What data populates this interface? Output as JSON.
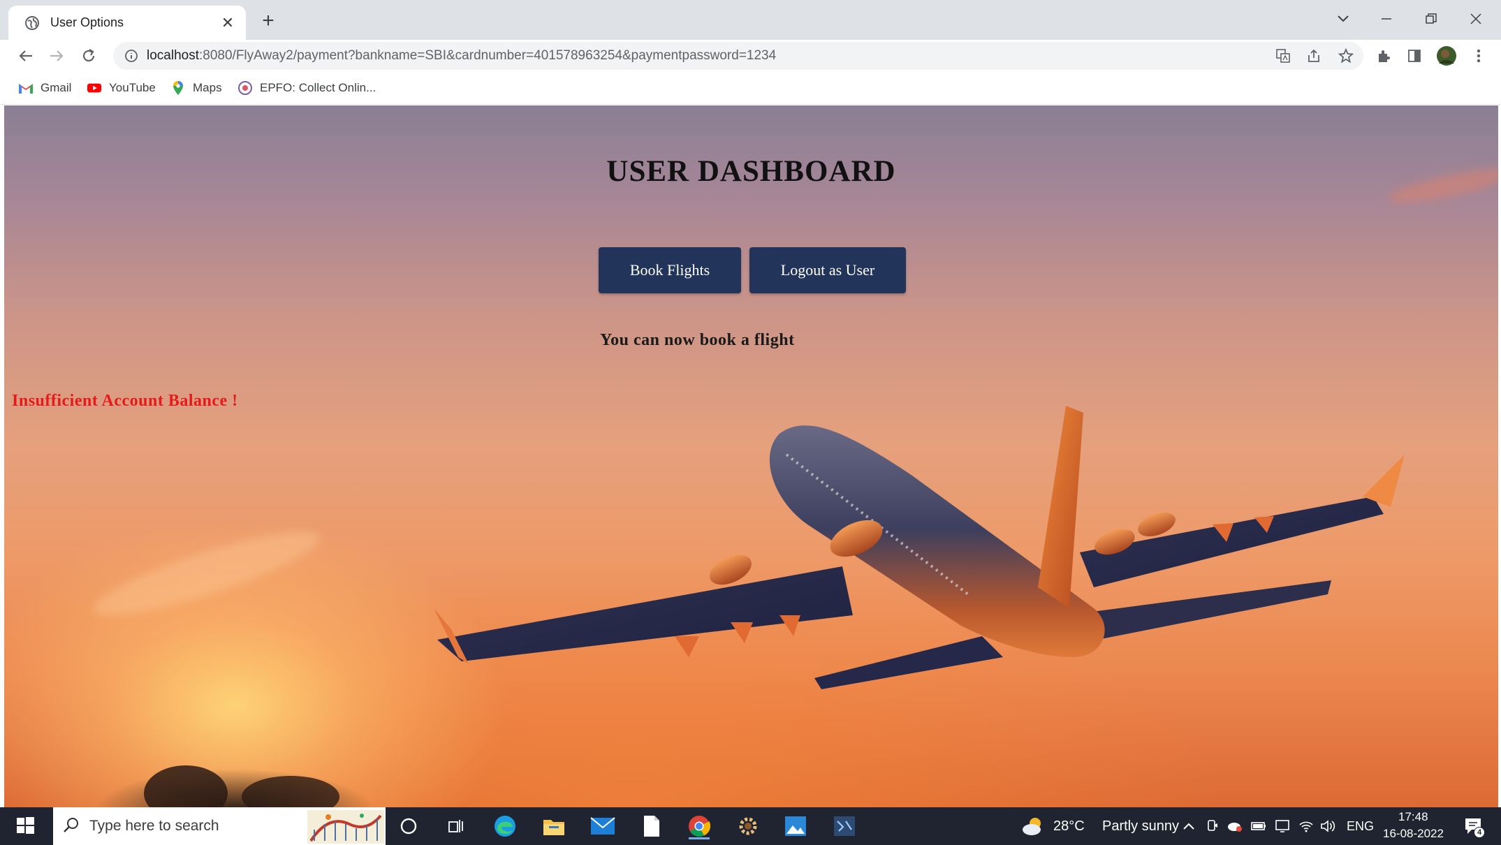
{
  "browser": {
    "tab_title": "User Options",
    "url_host": "localhost",
    "url_rest": ":8080/FlyAway2/payment?bankname=SBI&cardnumber=401578963254&paymentpassword=1234",
    "bookmarks": [
      {
        "label": "Gmail",
        "icon": "gmail-icon"
      },
      {
        "label": "YouTube",
        "icon": "youtube-icon"
      },
      {
        "label": "Maps",
        "icon": "maps-icon"
      },
      {
        "label": "EPFO: Collect Onlin...",
        "icon": "epfo-icon"
      }
    ]
  },
  "page": {
    "title": "USER DASHBOARD",
    "book_button": "Book Flights",
    "logout_button": "Logout as User",
    "message": "You can now book a flight",
    "error": "Insufficient Account Balance !",
    "error_color": "#e51b1b",
    "button_color": "#223459"
  },
  "taskbar": {
    "search_placeholder": "Type here to search",
    "weather_temp": "28°C",
    "weather_desc": "Partly sunny",
    "language": "ENG",
    "time": "17:48",
    "date": "16-08-2022",
    "notification_count": "4"
  }
}
